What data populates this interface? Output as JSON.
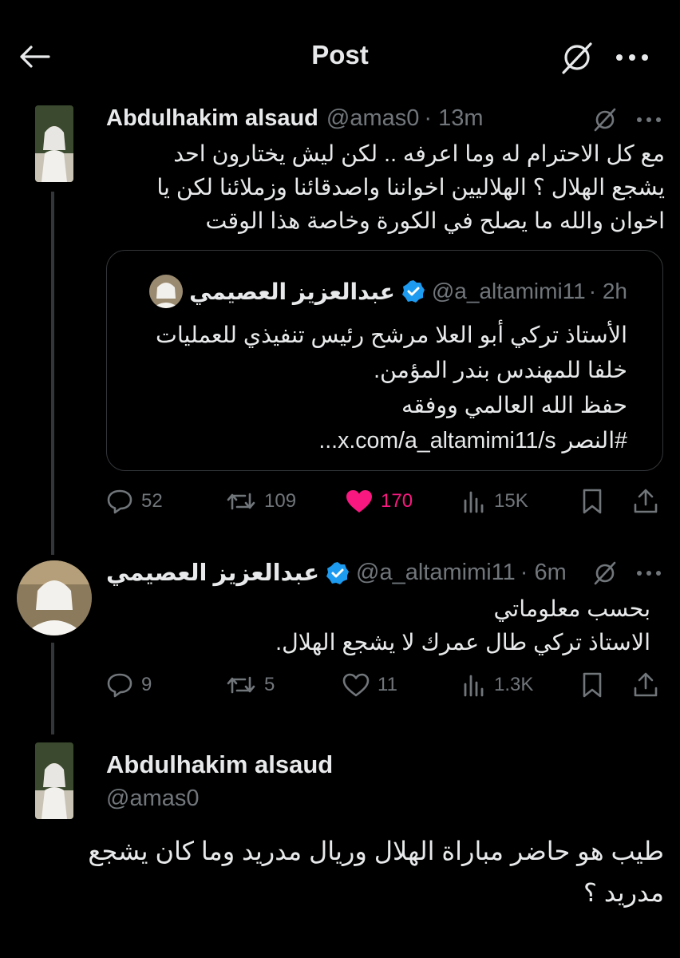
{
  "header": {
    "title": "Post"
  },
  "first_reply": {
    "name": "Abdulhakim alsaud",
    "handle": "@amas0",
    "time": "· 13m",
    "text_lines": [
      "مع كل الاحترام له وما اعرفه .. لكن ليش يختارون احد",
      "يشجع الهلال ؟ الهلاليين اخواننا واصدقائنا وزملائنا لكن يا",
      "اخوان والله ما يصلح في الكورة وخاصة هذا الوقت"
    ],
    "quote": {
      "name": "عبدالعزيز العصيمي",
      "handle": "@a_altamimi11",
      "time": "· 2h",
      "text_lines": [
        "الأستاذ تركي أبو العلا مرشح رئيس تنفيذي للعمليات",
        "خلفا للمهندس بندر المؤمن.",
        "حفظ الله العالمي ووفقه",
        "#النصر x.com/a_altamimi11/s..."
      ]
    },
    "actions": {
      "replies": "52",
      "reposts": "109",
      "likes": "170",
      "views": "15K"
    }
  },
  "second_reply": {
    "name": "عبدالعزيز العصيمي",
    "handle": "@a_altamimi11",
    "time": "· 6m",
    "text_lines": [
      "بحسب معلوماتي",
      "الاستاذ تركي طال عمرك لا يشجع الهلال."
    ],
    "actions": {
      "replies": "9",
      "reposts": "5",
      "likes": "11",
      "views": "1.3K"
    }
  },
  "main_post": {
    "name": "Abdulhakim alsaud",
    "handle": "@amas0",
    "text_lines": [
      "طيب هو حاضر مباراة الهلال وريال مدريد وما كان يشجع",
      "مدريد ؟"
    ]
  },
  "colors": {
    "like": "#f91880",
    "verified": "#1d9bf0",
    "muted": "#71767b",
    "background": "#000000"
  },
  "icons": [
    "back-arrow-icon",
    "grok-icon",
    "more-icon",
    "reply-icon",
    "repost-icon",
    "heart-icon",
    "views-icon",
    "bookmark-icon",
    "share-icon",
    "verified-icon"
  ]
}
